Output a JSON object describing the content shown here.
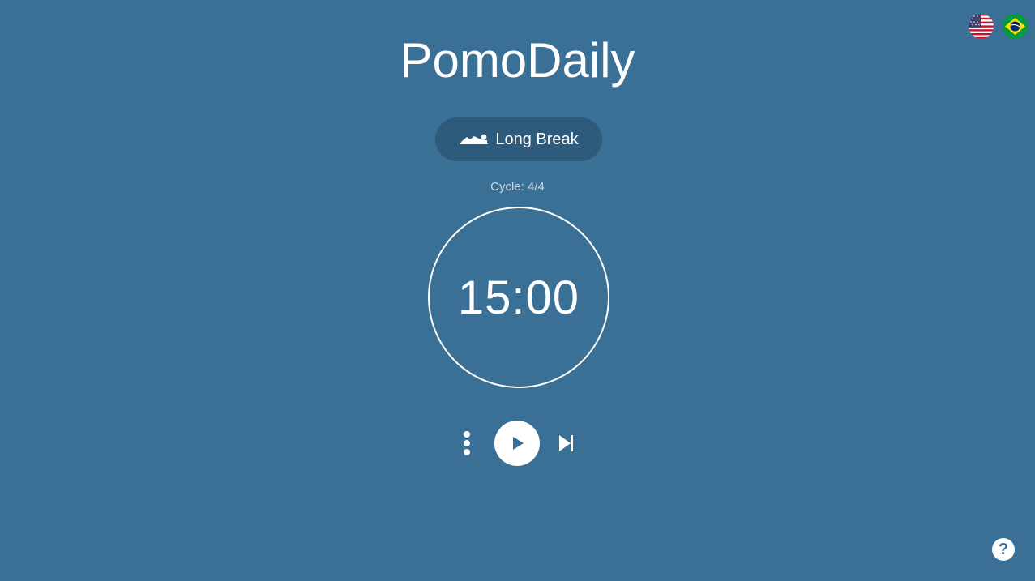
{
  "header": {
    "title": "PomoDaily"
  },
  "languages": [
    {
      "code": "en-US",
      "icon": "us-flag-icon"
    },
    {
      "code": "pt-BR",
      "icon": "brazil-flag-icon"
    }
  ],
  "mode": {
    "icon": "lying-person-icon",
    "label": "Long Break"
  },
  "cycle": {
    "text": "Cycle: 4/4"
  },
  "timer": {
    "display": "15:00"
  },
  "controls": {
    "more_icon": "vertical-dots-icon",
    "play_icon": "play-icon",
    "skip_icon": "skip-next-icon"
  },
  "help": {
    "label": "?"
  },
  "colors": {
    "background": "#3a7096",
    "pill": "#2e5b7c",
    "foreground": "#ffffff"
  }
}
